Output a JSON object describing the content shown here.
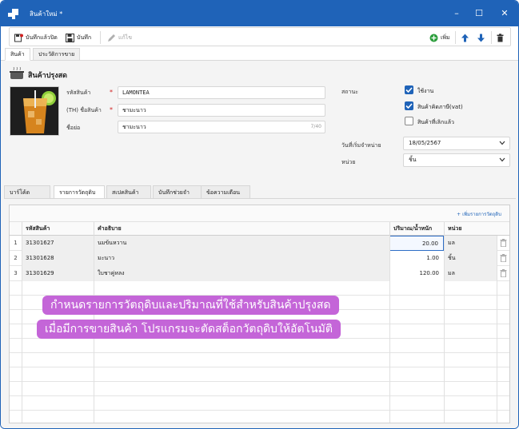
{
  "window": {
    "title": "สินค้าใหม่ *",
    "controls": {
      "minimize": "–",
      "maximize": "☐",
      "close": "✕"
    }
  },
  "toolbar": {
    "save_close": "บันทึกแล้วปิด",
    "save": "บันทึก",
    "edit": "แก้ไข",
    "add": "เพิ่ม"
  },
  "tabs_top": [
    "สินค้า",
    "ประวัติการขาย"
  ],
  "section": {
    "title": "สินค้าปรุงสด"
  },
  "form": {
    "code_label": "รหัสสินค้า",
    "code_value": "LAMONTEA",
    "name_label": "(TH) ชื่อสินค้า",
    "name_value": "ชามะนาว",
    "short_label": "ชื่อย่อ",
    "short_value": "ชามะนาว",
    "short_counter": "7/40",
    "status_label": "สถานะ",
    "active_label": "ใช้งาน",
    "active_checked": true,
    "vat_label": "สินค้าคิดภาษี(vat)",
    "vat_checked": true,
    "discontinued_label": "สินค้าที่เลิกแล้ว",
    "discontinued_checked": false,
    "start_date_label": "วันที่เริ่มจำหน่าย",
    "start_date_value": "18/05/2567",
    "unit_label": "หน่วย",
    "unit_value": "ชิ้น"
  },
  "tabs_low": [
    "บาร์โค้ด",
    "รายการวัตถุดิบ",
    "สเปคสินค้า",
    "บันทึกช่วยจำ",
    "ข้อความเตือน"
  ],
  "grid": {
    "add_link": "+ เพิ่มรายการวัตถุดิบ",
    "headers": {
      "code": "รหัสสินค้า",
      "desc": "คำอธิบาย",
      "qty": "ปริมาณ/น้ำหนัก",
      "unit": "หน่วย"
    },
    "rows": [
      {
        "no": "1",
        "code": "31301627",
        "desc": "นมข้นหวาน",
        "qty": "20.00",
        "unit": "มล"
      },
      {
        "no": "2",
        "code": "31301628",
        "desc": "มะนาว",
        "qty": "1.00",
        "unit": "ชิ้น"
      },
      {
        "no": "3",
        "code": "31301629",
        "desc": "ใบชาคู่หลง",
        "qty": "120.00",
        "unit": "มล"
      }
    ]
  },
  "banner": {
    "line1": "กำหนดรายการวัตถุดิบและปริมาณที่ใช้สำหรับสินค้าปรุงสด",
    "line2": "เมื่อมีการขายสินค้า โปรแกรมจะตัดสต็อกวัตถุดิบให้อัตโนมัติ"
  },
  "colors": {
    "accent": "#1f63b8",
    "banner": "#c465d8",
    "required": "#d02020",
    "add_green": "#2a9d3a"
  }
}
